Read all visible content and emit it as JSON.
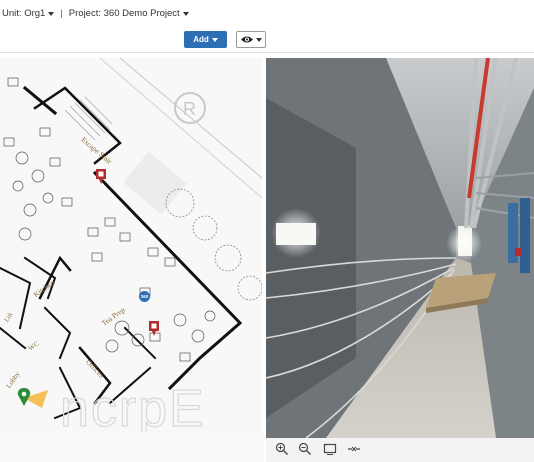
{
  "header": {
    "unit_label": "Unit:",
    "unit_value": "Org1",
    "separator": "|",
    "project_label": "Project:",
    "project_value": "360 Demo Project"
  },
  "toolbar": {
    "add_label": "Add"
  },
  "plan": {
    "rooms": {
      "escape_stair": "Escape Stair",
      "kitchen": "Kitchen",
      "tea_prep": "Tea Prep",
      "wc": "WC",
      "lobby": "Lobby",
      "offices": "Offices",
      "lift": "Lift"
    },
    "marker_badge": "360",
    "watermark": "®"
  },
  "pano_toolbar": {
    "icons": [
      "zoom-in-icon",
      "zoom-out-icon",
      "fit-screen-icon",
      "collapse-icon"
    ]
  },
  "colors": {
    "accent": "#2c6fb5",
    "marker": "#b52a2a",
    "marker_badge": "#2c6fb5",
    "location_pin": "#2e8b3a"
  }
}
